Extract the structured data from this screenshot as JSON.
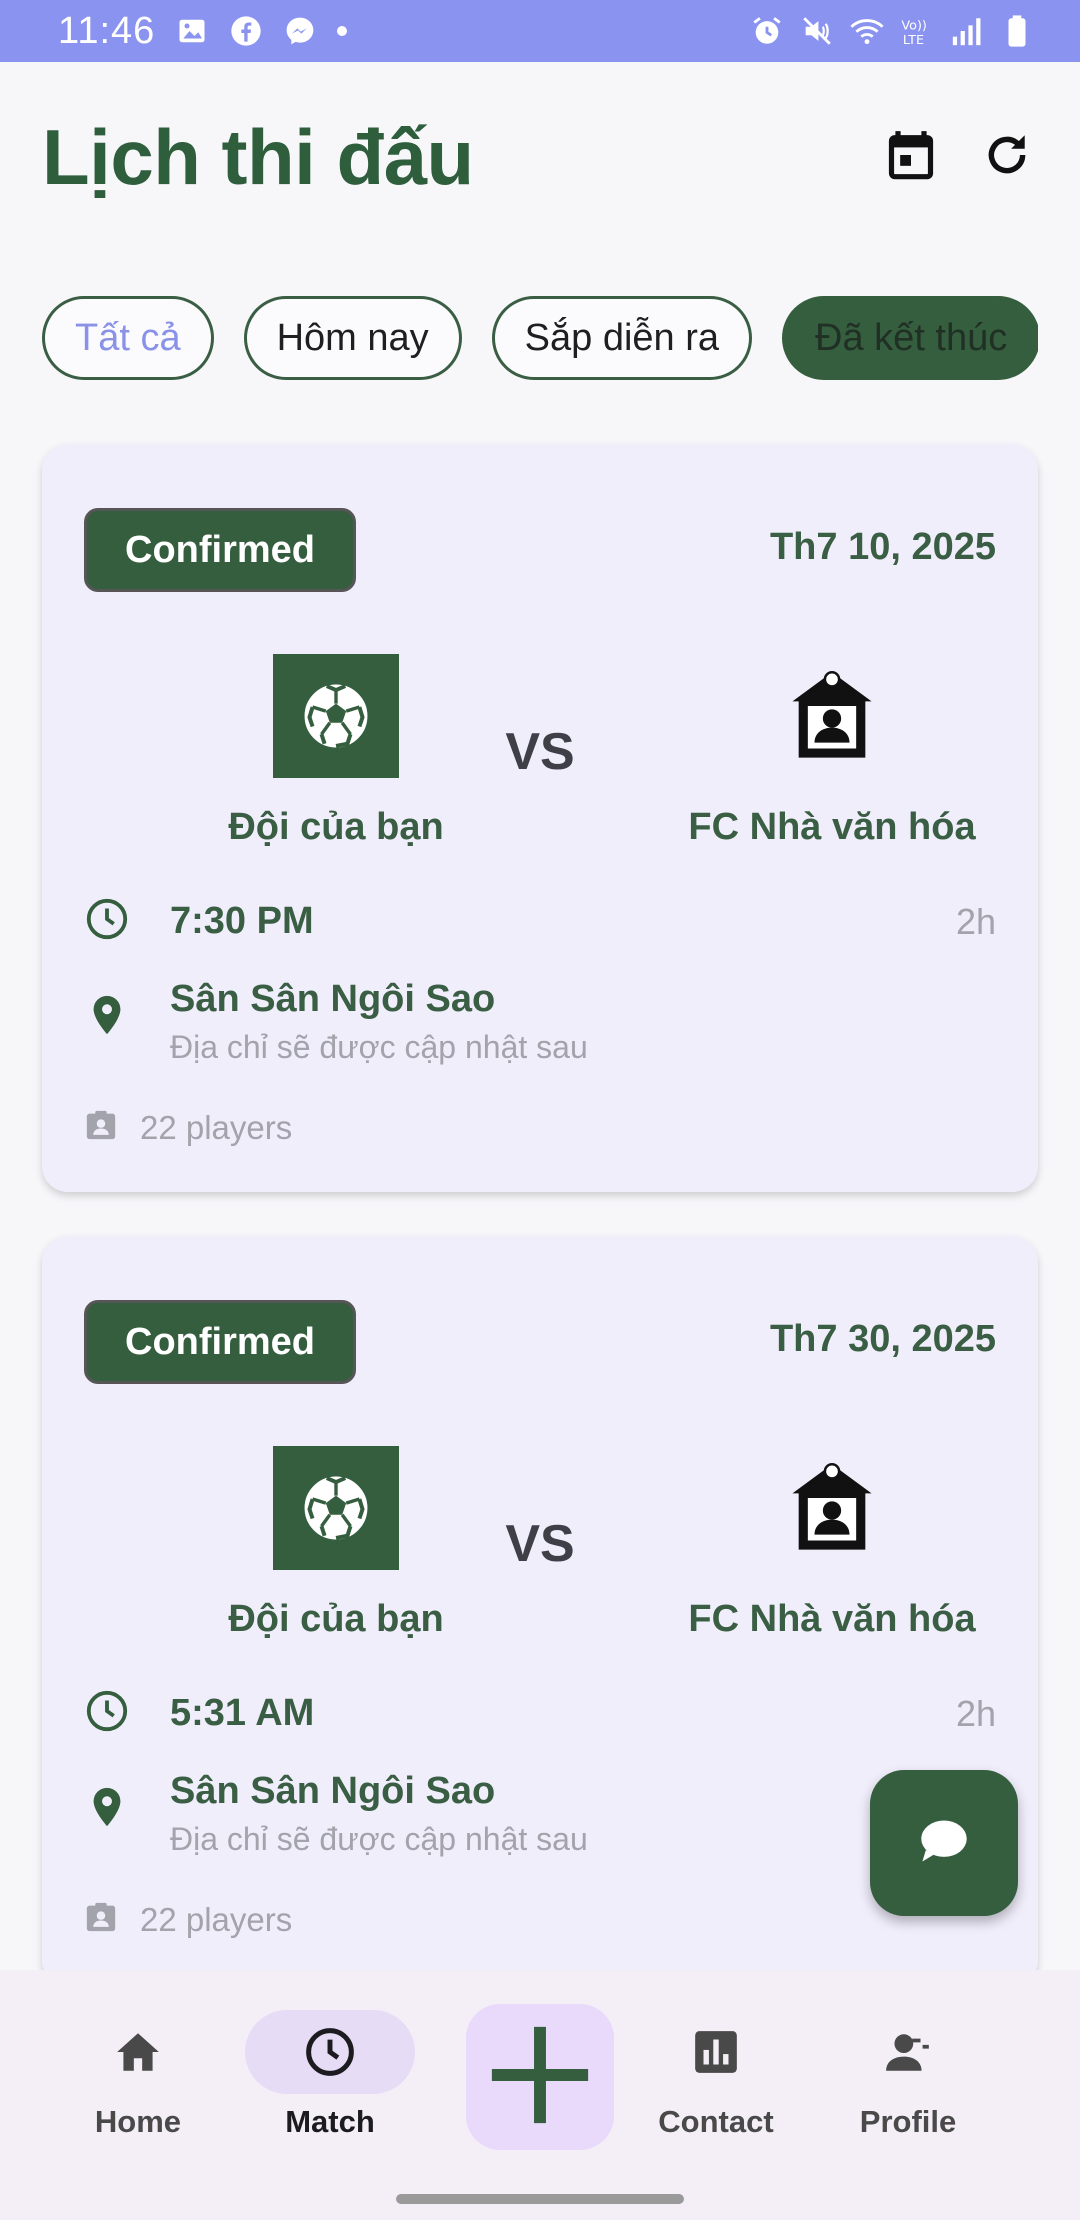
{
  "status_bar": {
    "time": "11:46",
    "left_icons": [
      "image-icon",
      "facebook-icon",
      "messenger-icon",
      "dot-icon"
    ],
    "right_icons": [
      "alarm-icon",
      "mute-icon",
      "wifi-icon",
      "volte-icon",
      "signal-icon",
      "battery-icon"
    ],
    "background": "#8a93ef"
  },
  "header": {
    "title": "Lịch thi đấu",
    "actions": [
      "calendar-icon",
      "refresh-icon"
    ]
  },
  "filters": [
    {
      "label": "Tất cả",
      "state": "selected"
    },
    {
      "label": "Hôm nay",
      "state": "default"
    },
    {
      "label": "Sắp diễn ra",
      "state": "default"
    },
    {
      "label": "Đã kết thúc",
      "state": "filled"
    }
  ],
  "matches": [
    {
      "status": "Confirmed",
      "date": "Th7 10, 2025",
      "home_team": "Đội của bạn",
      "vs": "VS",
      "away_team": "FC Nhà văn hóa",
      "time": "7:30 PM",
      "duration": "2h",
      "venue": "Sân Sân Ngôi Sao",
      "address": "Địa chỉ sẽ được cập nhật sau",
      "players": "22 players"
    },
    {
      "status": "Confirmed",
      "date": "Th7 30, 2025",
      "home_team": "Đội của bạn",
      "vs": "VS",
      "away_team": "FC Nhà văn hóa",
      "time": "5:31 AM",
      "duration": "2h",
      "venue": "Sân Sân Ngôi Sao",
      "address": "Địa chỉ sẽ được cập nhật sau",
      "players": "22 players"
    }
  ],
  "fab": {
    "icon": "chat-icon"
  },
  "bottom_nav": {
    "items": [
      {
        "label": "Home",
        "icon": "home-icon",
        "active": false
      },
      {
        "label": "Match",
        "icon": "clock-icon",
        "active": true
      },
      {
        "label": "Contact",
        "icon": "chart-icon",
        "active": false
      },
      {
        "label": "Profile",
        "icon": "person-icon",
        "active": false
      }
    ],
    "center_action": "plus-icon"
  },
  "colors": {
    "primary_green": "#355e3f",
    "title_green": "#2f5e3d",
    "card_background": "#f1eefc",
    "accent_blue": "#8a92e8"
  }
}
